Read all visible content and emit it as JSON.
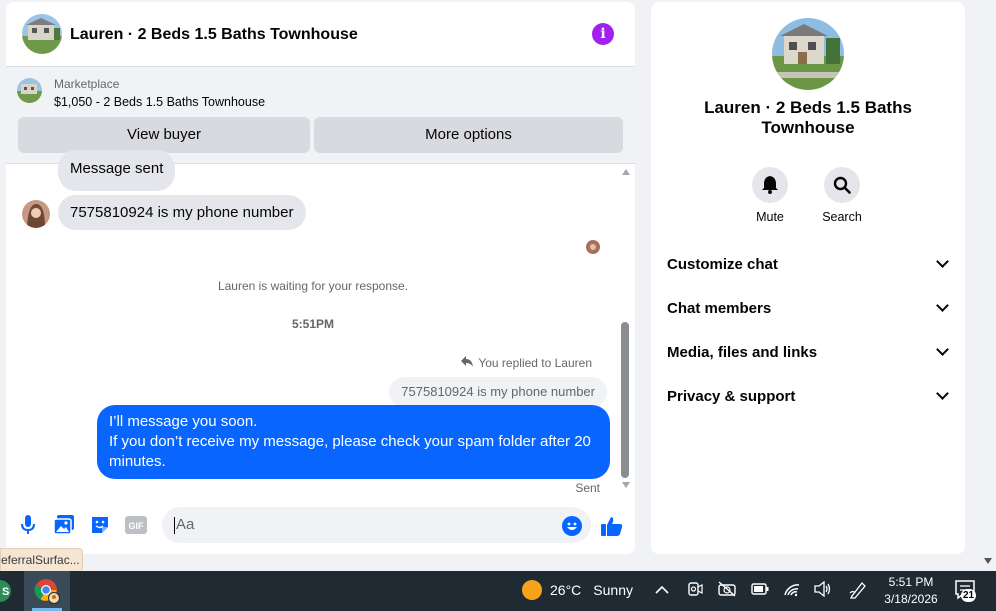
{
  "chat": {
    "title": "Lauren · 2 Beds 1.5 Baths Townhouse",
    "info_icon": "info-icon",
    "marketplace": {
      "label": "Marketplace",
      "listing": "$1,050 - 2 Beds 1.5 Baths Townhouse",
      "view_buyer": "View buyer",
      "more_options": "More options"
    },
    "messages": {
      "previous_sent": "Message sent",
      "incoming_phone": "7575810924 is my phone number",
      "waiting": "Lauren is waiting for your response.",
      "time_separator": "5:51PM",
      "replied_label": "You replied to Lauren",
      "quoted": "7575810924 is my phone number",
      "outgoing_line1": "I’ll message you soon.",
      "outgoing_line2": "If you don’t receive my message, please check your spam folder after 20",
      "outgoing_line3": "minutes.",
      "status": "Sent"
    },
    "composer": {
      "placeholder": "Aa"
    }
  },
  "side": {
    "title_line1": "Lauren · 2 Beds 1.5 Baths",
    "title_line2": "Townhouse",
    "mute_label": "Mute",
    "search_label": "Search",
    "sections": [
      "Customize chat",
      "Chat members",
      "Media, files and links",
      "Privacy & support"
    ]
  },
  "taskbar": {
    "tooltip": "eferralSurfac...",
    "temperature": "26°C",
    "weather": "Sunny",
    "time": "5:51 PM",
    "date": "3/18/2026",
    "notifications": "21"
  },
  "colors": {
    "accent": "#0866ff",
    "info": "#a020f0",
    "taskbar": "#1f2a33"
  }
}
